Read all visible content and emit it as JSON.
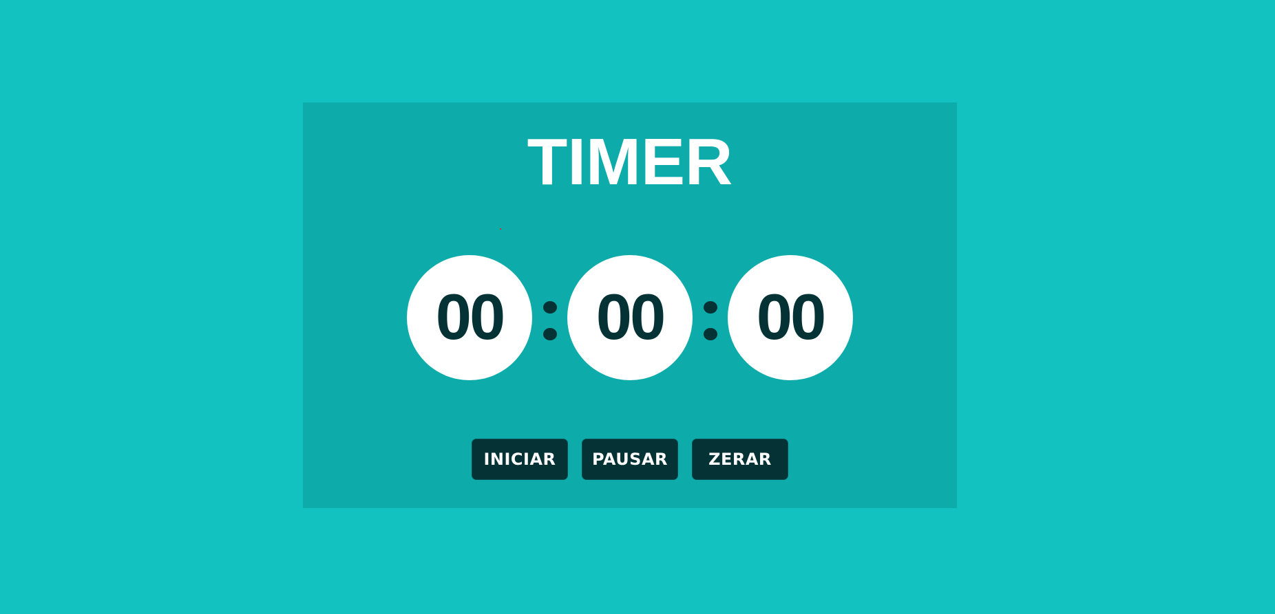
{
  "page": {
    "background_color": "#11c2c0",
    "panel_color": "#0dacaa"
  },
  "timer": {
    "title": "TIMER",
    "hours": "00",
    "minutes": "00",
    "seconds": "00",
    "separator": ":",
    "digit_color": "#053235"
  },
  "controls": {
    "start_label": "INICIAR",
    "pause_label": "PAUSAR",
    "reset_label": "ZERAR",
    "button_color": "#053235"
  }
}
